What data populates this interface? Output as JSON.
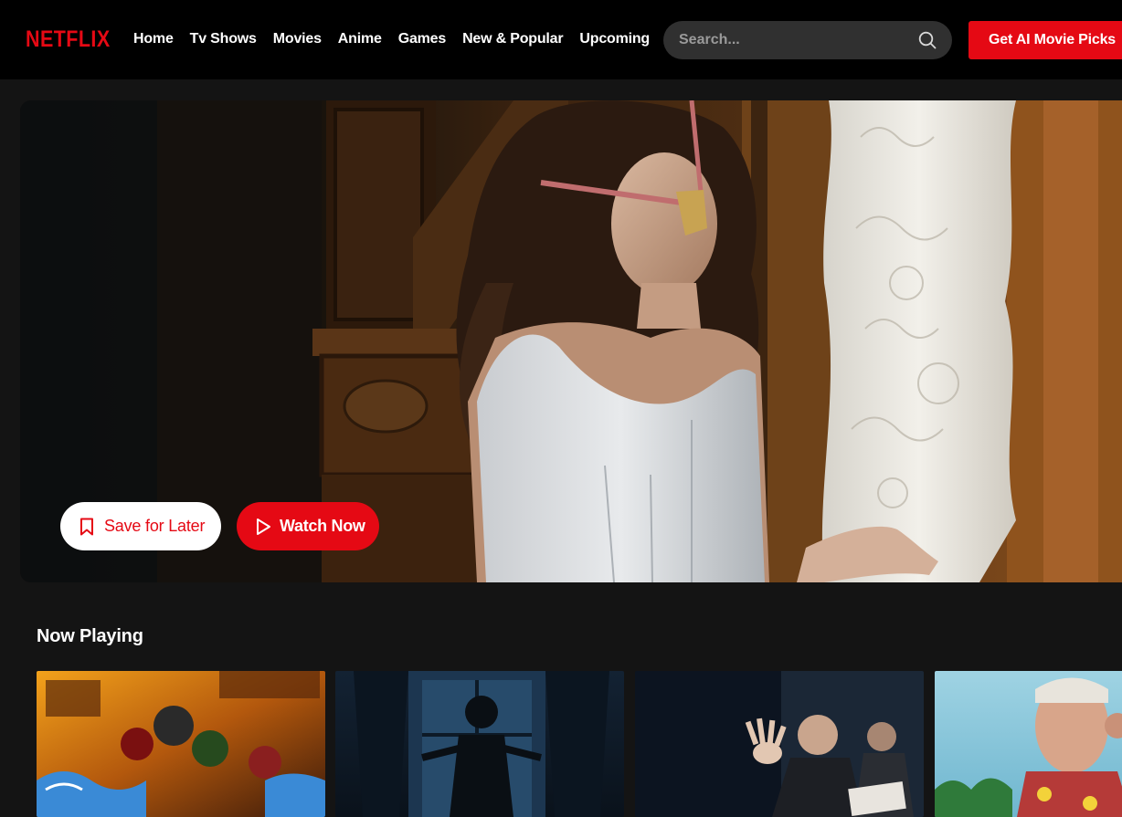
{
  "navbar": {
    "logo": "NETFLIX",
    "links": [
      "Home",
      "Tv Shows",
      "Movies",
      "Anime",
      "Games",
      "New & Popular",
      "Upcoming"
    ],
    "search_placeholder": "Search...",
    "cta_label": "Get AI Movie Picks"
  },
  "hero": {
    "save_label": "Save for Later",
    "watch_label": "Watch Now"
  },
  "row": {
    "title": "Now Playing"
  },
  "colors": {
    "brand": "#e50914",
    "background": "#141414",
    "nav_bg": "#000000",
    "search_bg": "#303030"
  },
  "icons": {
    "search": "search-icon",
    "bookmark": "bookmark-icon",
    "play": "play-icon"
  }
}
